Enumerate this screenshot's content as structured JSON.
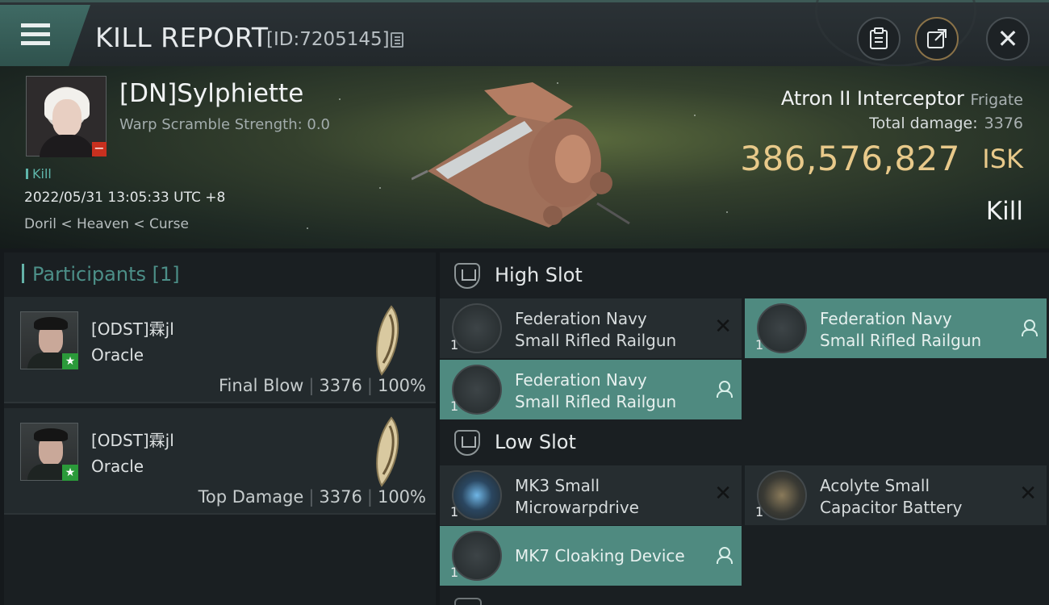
{
  "header": {
    "title": "KILL REPORT",
    "report_id": "[ID:7205145]",
    "icons": [
      "menu-icon",
      "copy-icon",
      "clipboard-icon",
      "share-icon",
      "close-icon"
    ]
  },
  "victim": {
    "name": "[DN]Sylphiette",
    "warp_scramble": "Warp Scramble Strength: 0.0",
    "kill_tag": "Kill",
    "time": "2022/05/31 13:05:33 UTC +8",
    "location": "Doril < Heaven < Curse",
    "ship_name": "Atron II Interceptor",
    "ship_class": "Frigate",
    "total_damage_label": "Total damage:",
    "total_damage_value": "3376",
    "isk_value": "386,576,827",
    "isk_unit": "ISK",
    "result": "Kill"
  },
  "participants": {
    "title": "Participants [1]",
    "rows": [
      {
        "name": "[ODST]霖jl",
        "ship": "Oracle",
        "role": "Final Blow",
        "damage": "3376",
        "percent": "100%"
      },
      {
        "name": "[ODST]霖jl",
        "ship": "Oracle",
        "role": "Top Damage",
        "damage": "3376",
        "percent": "100%"
      }
    ]
  },
  "fitting": {
    "high_slot_title": "High Slot",
    "low_slot_title": "Low Slot",
    "high_slot": [
      {
        "qty": "1",
        "line1": "Federation Navy",
        "line2": "Small Rifled Railgun",
        "status": "destroyed"
      },
      {
        "qty": "1",
        "line1": "Federation Navy",
        "line2": "Small Rifled Railgun",
        "status": "dropped"
      },
      {
        "qty": "1",
        "line1": "Federation Navy",
        "line2": "Small Rifled Railgun",
        "status": "dropped"
      }
    ],
    "low_slot": [
      {
        "qty": "1",
        "line1": "MK3 Small",
        "line2": "Microwarpdrive",
        "status": "destroyed"
      },
      {
        "qty": "1",
        "line1": "Acolyte Small",
        "line2": "Capacitor Battery",
        "status": "destroyed"
      },
      {
        "qty": "1",
        "line1": "MK7 Cloaking Device",
        "line2": "",
        "status": "dropped"
      }
    ]
  },
  "colors": {
    "accent_teal": "#4f8a80",
    "isk_gold": "#e8c98a",
    "kill_badge_red": "#c8301f",
    "participant_star_green": "#2b9a3a"
  }
}
